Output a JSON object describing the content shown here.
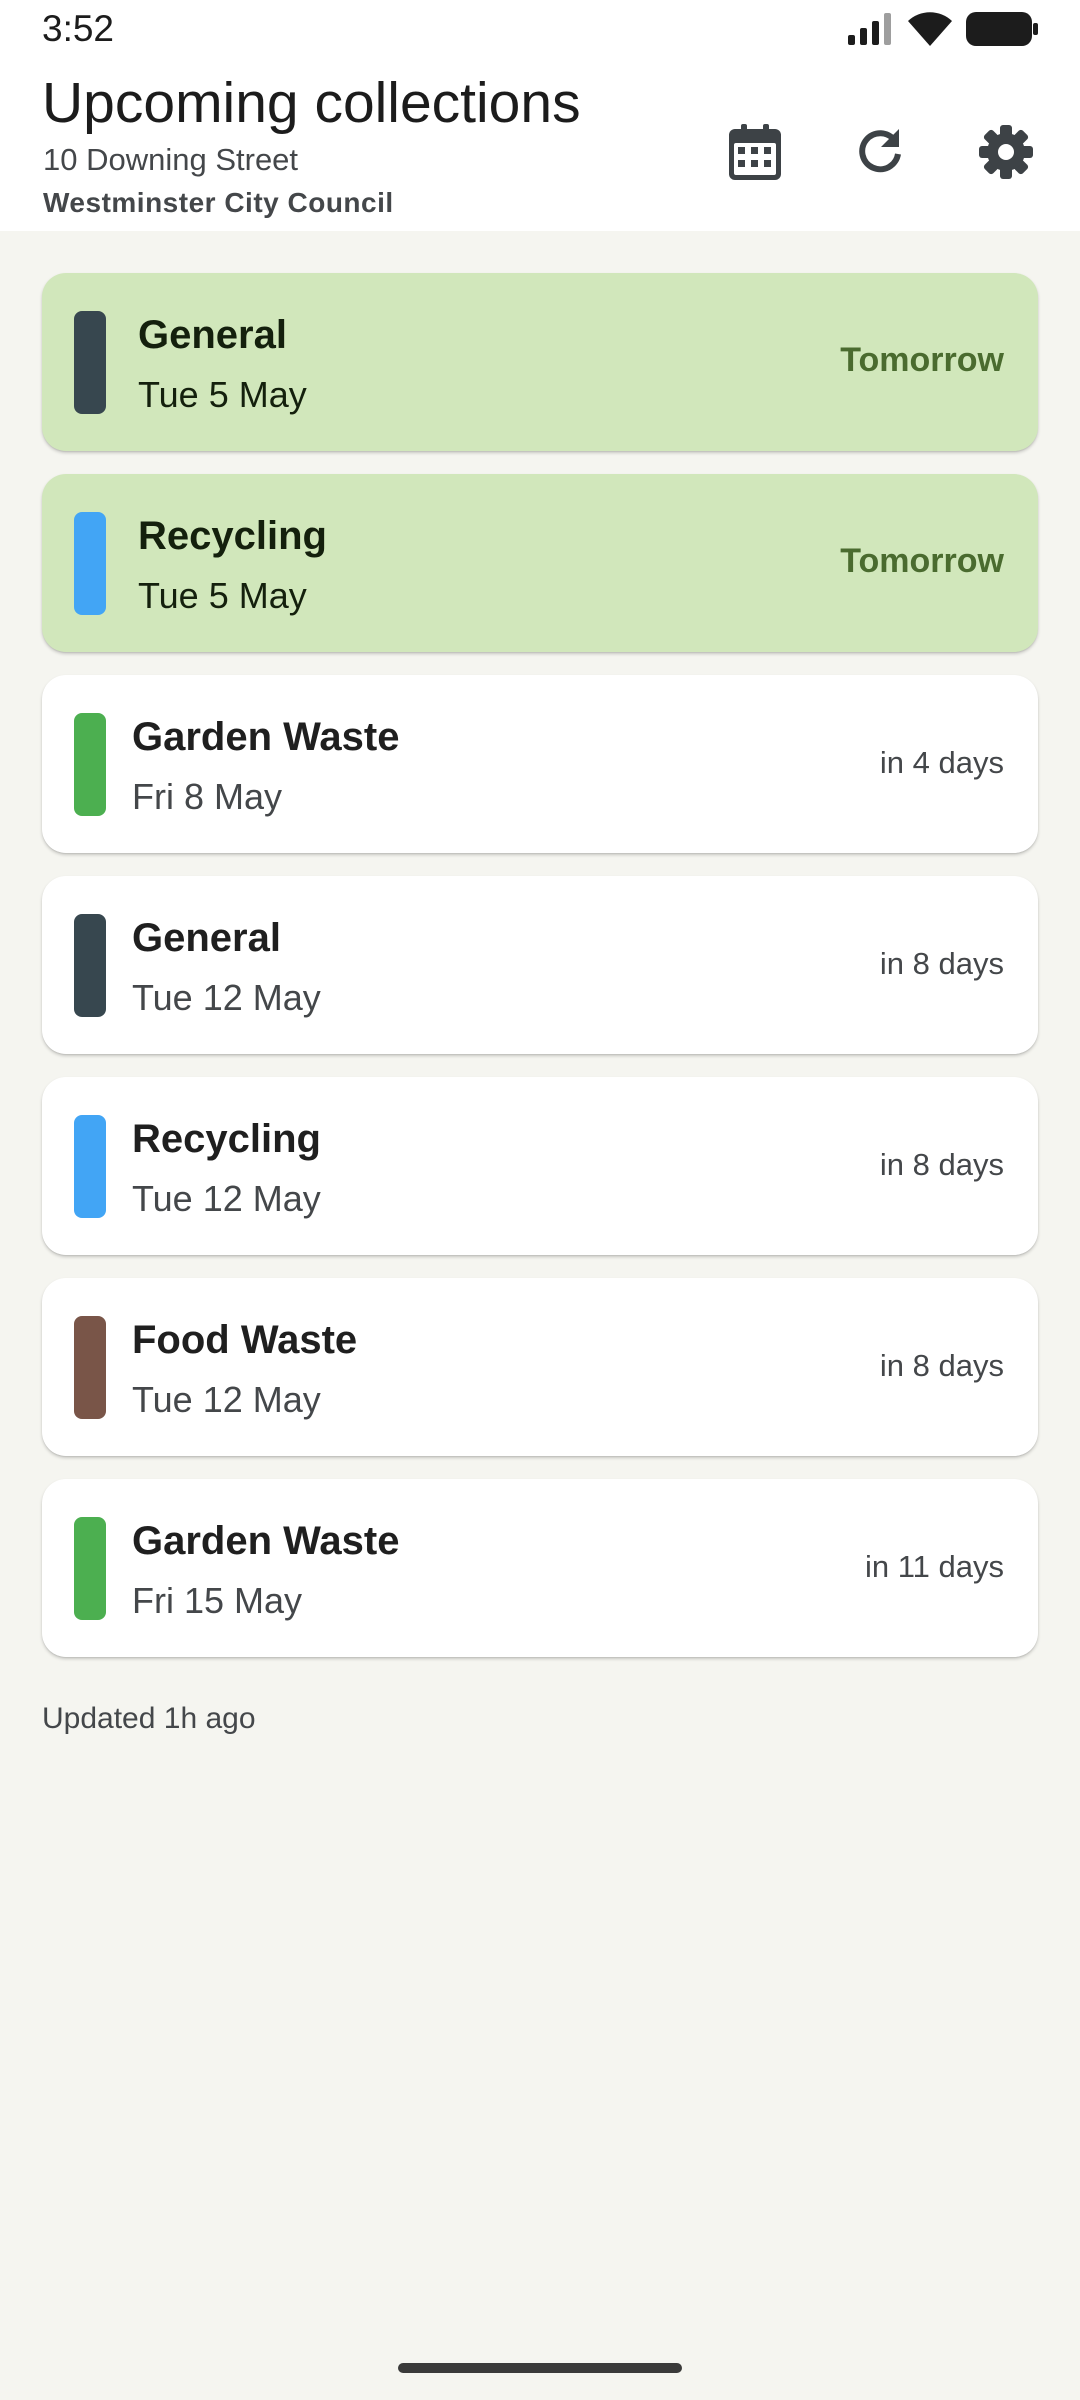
{
  "status_bar": {
    "time": "3:52",
    "icons": [
      "signal-icon",
      "wifi-icon",
      "battery-icon"
    ]
  },
  "header": {
    "title": "Upcoming collections",
    "address": "10 Downing Street",
    "council": "Westminster City Council",
    "actions": [
      "calendar-icon",
      "refresh-icon",
      "settings-icon"
    ]
  },
  "collections": [
    {
      "name": "General",
      "date": "Tue 5 May",
      "when": "Tomorrow",
      "color": "#37474f",
      "highlight": true
    },
    {
      "name": "Recycling",
      "date": "Tue 5 May",
      "when": "Tomorrow",
      "color": "#42a5f5",
      "highlight": true
    },
    {
      "name": "Garden Waste",
      "date": "Fri 8 May",
      "when": "in 4 days",
      "color": "#4caf50",
      "highlight": false
    },
    {
      "name": "General",
      "date": "Tue 12 May",
      "when": "in 8 days",
      "color": "#37474f",
      "highlight": false
    },
    {
      "name": "Recycling",
      "date": "Tue 12 May",
      "when": "in 8 days",
      "color": "#42a5f5",
      "highlight": false
    },
    {
      "name": "Food Waste",
      "date": "Tue 12 May",
      "when": "in 8 days",
      "color": "#795548",
      "highlight": false
    },
    {
      "name": "Garden Waste",
      "date": "Fri 15 May",
      "when": "in 11 days",
      "color": "#4caf50",
      "highlight": false
    }
  ],
  "footer": {
    "updated": "Updated 1h ago"
  },
  "colors": {
    "highlight_card": "#d1e7bb",
    "highlight_text": "#4a6b2f",
    "background": "#f5f5f0"
  }
}
